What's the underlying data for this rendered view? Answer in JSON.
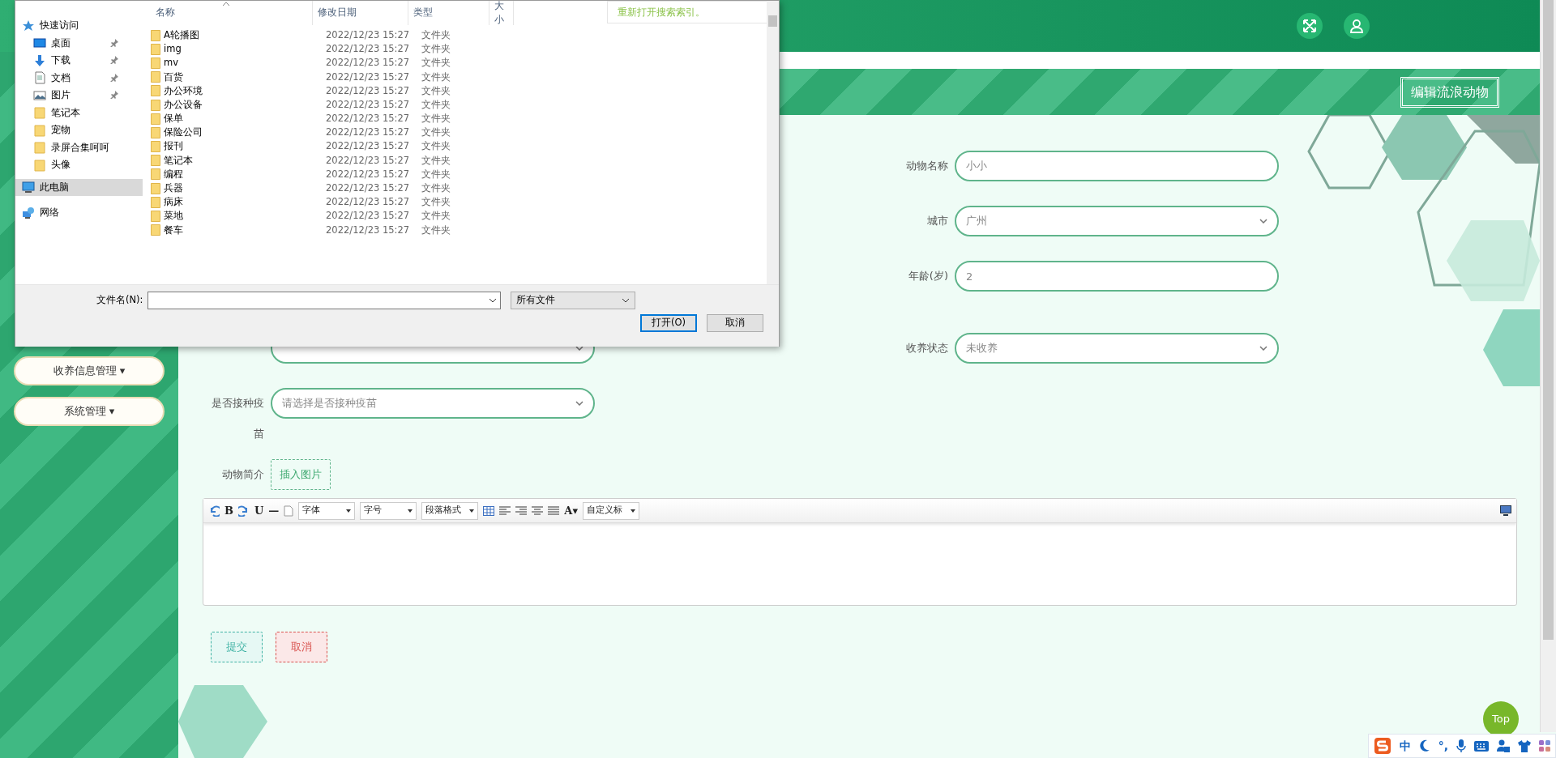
{
  "page_title": "编辑流浪动物",
  "sidebar": {
    "items": [
      {
        "label": "收养信息管理",
        "caret": "▾"
      },
      {
        "label": "系统管理",
        "caret": "▾"
      }
    ]
  },
  "form": {
    "right_fields": [
      {
        "label": "动物名称",
        "kind": "input",
        "value": "小小"
      },
      {
        "label": "城市",
        "kind": "select",
        "value": "广州"
      },
      {
        "label": "年龄(岁)",
        "kind": "input",
        "value": "2"
      },
      {
        "label": "收养状态",
        "kind": "select",
        "value": "未收养"
      }
    ],
    "left_fields": [
      {
        "kind": "select"
      },
      {
        "label": "是否接种疫苗",
        "kind": "select",
        "placeholder": "请选择是否接种疫苗"
      }
    ],
    "intro_label": "动物简介",
    "insert_image_button": "插入图片",
    "editor_toolbar": [
      {
        "kind": "undo"
      },
      {
        "kind": "glyph",
        "text": "B"
      },
      {
        "kind": "redo"
      },
      {
        "kind": "glyph",
        "text": "U"
      },
      {
        "kind": "glyph",
        "text": "—"
      },
      {
        "kind": "page"
      },
      {
        "kind": "select",
        "text": "字体"
      },
      {
        "kind": "select",
        "text": "字号"
      },
      {
        "kind": "select",
        "text": "段落格式"
      },
      {
        "kind": "table"
      },
      {
        "kind": "align-left"
      },
      {
        "kind": "align-right"
      },
      {
        "kind": "align-center"
      },
      {
        "kind": "justify"
      },
      {
        "kind": "glyph",
        "text": "A▾"
      },
      {
        "kind": "select",
        "text": "自定义标"
      },
      {
        "kind": "preview"
      }
    ],
    "submit_button": "提交",
    "cancel_button": "取消"
  },
  "top_button": "Top",
  "ime_toolbar": [
    {
      "kind": "logo"
    },
    {
      "kind": "text",
      "text": "中"
    },
    {
      "kind": "moon"
    },
    {
      "kind": "text",
      "text": "°,"
    },
    {
      "kind": "mic"
    },
    {
      "kind": "keyboard"
    },
    {
      "kind": "user"
    },
    {
      "kind": "shirt"
    },
    {
      "kind": "grid"
    }
  ],
  "file_dialog": {
    "nav": [
      {
        "label": "快速访问",
        "kind": "star",
        "pinned": false,
        "selected": false,
        "children": [
          {
            "label": "桌面",
            "kind": "desktop",
            "pinned": true,
            "selected": false
          },
          {
            "label": "下载",
            "kind": "download",
            "pinned": true,
            "selected": false
          },
          {
            "label": "文档",
            "kind": "document",
            "pinned": true,
            "selected": false
          },
          {
            "label": "图片",
            "kind": "picture",
            "pinned": true,
            "selected": false
          },
          {
            "label": "笔记本",
            "kind": "folder",
            "pinned": false,
            "selected": false
          },
          {
            "label": "宠物",
            "kind": "folder",
            "pinned": false,
            "selected": false
          },
          {
            "label": "录屏合集呵呵",
            "kind": "folder",
            "pinned": false,
            "selected": false
          },
          {
            "label": "头像",
            "kind": "folder",
            "pinned": false,
            "selected": false
          }
        ]
      },
      {
        "label": "此电脑",
        "kind": "computer",
        "pinned": false,
        "selected": true
      },
      {
        "label": "网络",
        "kind": "network",
        "pinned": false,
        "selected": false
      }
    ],
    "columns": [
      "名称",
      "修改日期",
      "类型",
      "大小"
    ],
    "search_tip": "重新打开搜索索引。",
    "files": [
      {
        "name": "A轮播图",
        "date": "2022/12/23 15:27",
        "type": "文件夹"
      },
      {
        "name": "img",
        "date": "2022/12/23 15:27",
        "type": "文件夹"
      },
      {
        "name": "mv",
        "date": "2022/12/23 15:27",
        "type": "文件夹"
      },
      {
        "name": "百货",
        "date": "2022/12/23 15:27",
        "type": "文件夹"
      },
      {
        "name": "办公环境",
        "date": "2022/12/23 15:27",
        "type": "文件夹"
      },
      {
        "name": "办公设备",
        "date": "2022/12/23 15:27",
        "type": "文件夹"
      },
      {
        "name": "保单",
        "date": "2022/12/23 15:27",
        "type": "文件夹"
      },
      {
        "name": "保险公司",
        "date": "2022/12/23 15:27",
        "type": "文件夹"
      },
      {
        "name": "报刊",
        "date": "2022/12/23 15:27",
        "type": "文件夹"
      },
      {
        "name": "笔记本",
        "date": "2022/12/23 15:27",
        "type": "文件夹"
      },
      {
        "name": "编程",
        "date": "2022/12/23 15:27",
        "type": "文件夹"
      },
      {
        "name": "兵器",
        "date": "2022/12/23 15:27",
        "type": "文件夹"
      },
      {
        "name": "病床",
        "date": "2022/12/23 15:27",
        "type": "文件夹"
      },
      {
        "name": "菜地",
        "date": "2022/12/23 15:27",
        "type": "文件夹"
      },
      {
        "name": "餐车",
        "date": "2022/12/23 15:27",
        "type": "文件夹"
      }
    ],
    "filename_label": "文件名(N):",
    "file_type": "所有文件",
    "open_button": "打开(O)",
    "cancel_button": "取消"
  }
}
